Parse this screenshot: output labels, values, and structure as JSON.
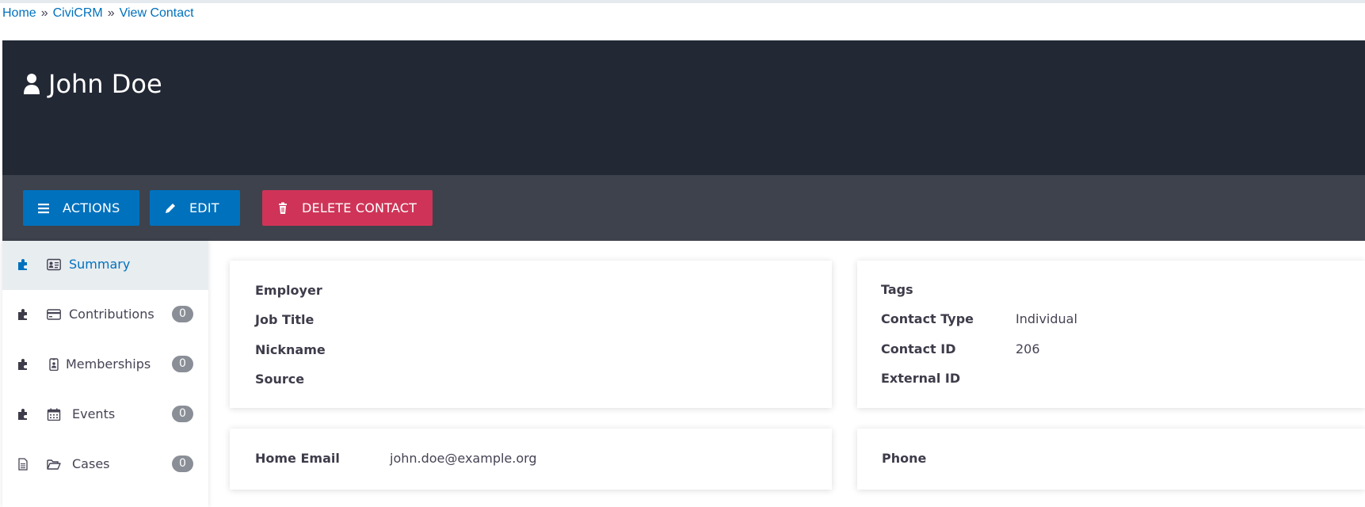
{
  "breadcrumb": {
    "home": "Home",
    "civicrm": "CiviCRM",
    "view_contact": "View Contact",
    "separator": "»"
  },
  "contact": {
    "name": "John Doe",
    "icon": "user-icon"
  },
  "actions": {
    "actions_label": "ACTIONS",
    "edit_label": "EDIT",
    "delete_label": "DELETE CONTACT"
  },
  "tabs": [
    {
      "label": "Summary",
      "count": "",
      "icon": "id-card-icon",
      "left_icon": "puzzle-icon",
      "active": true
    },
    {
      "label": "Contributions",
      "count": "0",
      "icon": "credit-card-icon",
      "left_icon": "puzzle-icon"
    },
    {
      "label": "Memberships",
      "count": "0",
      "icon": "id-badge-icon",
      "left_icon": "puzzle-icon"
    },
    {
      "label": "Events",
      "count": "0",
      "icon": "calendar-icon",
      "left_icon": "puzzle-icon"
    },
    {
      "label": "Cases",
      "count": "0",
      "icon": "folder-open-icon",
      "left_icon": "file-icon"
    }
  ],
  "summary": {
    "employer_label": "Employer",
    "job_title_label": "Job Title",
    "nickname_label": "Nickname",
    "source_label": "Source",
    "tags_label": "Tags",
    "contact_type_label": "Contact Type",
    "contact_type_value": "Individual",
    "contact_id_label": "Contact ID",
    "contact_id_value": "206",
    "external_id_label": "External ID",
    "home_email_label": "Home Email",
    "home_email_value": "john.doe@example.org",
    "phone_label": "Phone"
  },
  "colors": {
    "header_bg": "#222834",
    "action_bar_bg": "#3e424c",
    "primary": "#0071bd",
    "danger": "#cf3458",
    "link": "#0071bd"
  }
}
